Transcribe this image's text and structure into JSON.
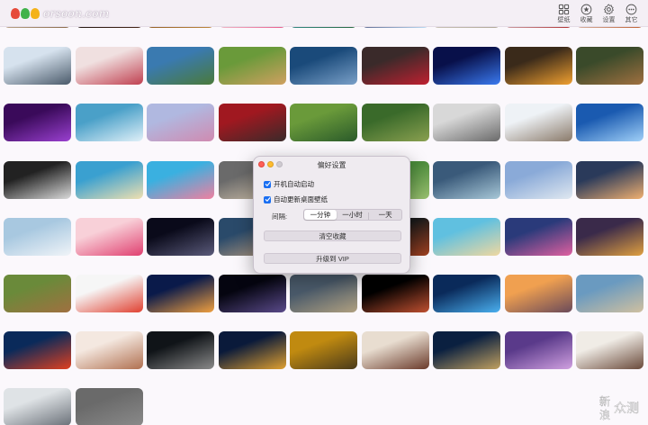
{
  "app": {
    "logo_text": "orsoon.com",
    "logo_letters": [
      "d",
      "i",
      "y"
    ],
    "watermark_text": "新浪众测"
  },
  "toolbar": {
    "buttons": [
      {
        "label": "壁纸",
        "icon": "grid-icon"
      },
      {
        "label": "收藏",
        "icon": "star-icon"
      },
      {
        "label": "设置",
        "icon": "gear-icon"
      },
      {
        "label": "其它",
        "icon": "more-icon"
      }
    ]
  },
  "gallery": {
    "tiles": [
      {
        "subject": "white bird flying",
        "colors": [
          "#d8c8b0",
          "#8a6a4a"
        ]
      },
      {
        "subject": "sports car at night",
        "colors": [
          "#121212",
          "#4a2a1a"
        ]
      },
      {
        "subject": "lion",
        "colors": [
          "#7a4a1a",
          "#c08a40"
        ]
      },
      {
        "subject": "happy birthday cupcakes",
        "colors": [
          "#f6f4ee",
          "#e85a8a"
        ]
      },
      {
        "subject": "green islands bay",
        "colors": [
          "#3aa0b0",
          "#2a6a40"
        ]
      },
      {
        "subject": "fantasy ice castle",
        "colors": [
          "#2a2a5a",
          "#c0e0f8"
        ]
      },
      {
        "subject": "desert lizard",
        "colors": [
          "#d8d2c8",
          "#b0a898"
        ]
      },
      {
        "subject": "red car and house",
        "colors": [
          "#dfe6ee",
          "#b03030"
        ]
      },
      {
        "subject": "fox in snow",
        "colors": [
          "#e6e8ee",
          "#c06030"
        ]
      },
      {
        "subject": "snowy mountains",
        "colors": [
          "#d6e2ee",
          "#4a5a6a"
        ]
      },
      {
        "subject": "cherry blossom village",
        "colors": [
          "#f0e0e0",
          "#c04050"
        ]
      },
      {
        "subject": "alpine lake",
        "colors": [
          "#3a7ab0",
          "#4a7a3a"
        ]
      },
      {
        "subject": "kitten on grass",
        "colors": [
          "#6a9a3a",
          "#d0a060"
        ]
      },
      {
        "subject": "blue lake at dusk",
        "colors": [
          "#1a4a7a",
          "#7aa0c8"
        ]
      },
      {
        "subject": "woman in red",
        "colors": [
          "#3a2a2a",
          "#c02030"
        ]
      },
      {
        "subject": "blue butterfly",
        "colors": [
          "#08104a",
          "#3a7af0"
        ]
      },
      {
        "subject": "sunset field tree",
        "colors": [
          "#3a2a1a",
          "#f0a030"
        ]
      },
      {
        "subject": "monkey in forest",
        "colors": [
          "#3a4a2a",
          "#a07040"
        ]
      },
      {
        "subject": "purple abstract",
        "colors": [
          "#3a0a5a",
          "#9a40d0"
        ]
      },
      {
        "subject": "helicopter over sea",
        "colors": [
          "#4aa0c8",
          "#e0f0f8"
        ]
      },
      {
        "subject": "hydrangea flowers",
        "colors": [
          "#b0b8e0",
          "#d08ab0"
        ]
      },
      {
        "subject": "red abstract",
        "colors": [
          "#a01820",
          "#3a2a2a"
        ]
      },
      {
        "subject": "green abstract",
        "colors": [
          "#6a9a3a",
          "#2a5a2a"
        ]
      },
      {
        "subject": "forest green",
        "colors": [
          "#3a6a2a",
          "#8aa050"
        ]
      },
      {
        "subject": "modern house with car",
        "colors": [
          "#d8d8d8",
          "#6a6a6a"
        ]
      },
      {
        "subject": "house in snow",
        "colors": [
          "#eef2f6",
          "#8a7a6a"
        ]
      },
      {
        "subject": "blue light hand",
        "colors": [
          "#1a5ab0",
          "#a0d0f8"
        ]
      },
      {
        "subject": "dark monochrome scene",
        "colors": [
          "#222222",
          "#dadada"
        ]
      },
      {
        "subject": "beach with deck chairs",
        "colors": [
          "#3aa0d0",
          "#f0e0b0"
        ]
      },
      {
        "subject": "dog with sunglasses",
        "colors": [
          "#3ab0e0",
          "#f080a0"
        ]
      },
      {
        "subject": "two kittens",
        "colors": [
          "#6a6a6a",
          "#d8c8b0"
        ]
      },
      {
        "subject": "lamp with sheep",
        "colors": [
          "#c8c8d0",
          "#8a8a92"
        ]
      },
      {
        "subject": "green sky",
        "colors": [
          "#4a8a3a",
          "#9ac070"
        ]
      },
      {
        "subject": "aerial river",
        "colors": [
          "#3a5a7a",
          "#a8c8d8"
        ]
      },
      {
        "subject": "jet plane over clouds",
        "colors": [
          "#8aaad8",
          "#e0e8f0"
        ]
      },
      {
        "subject": "pier at sunset",
        "colors": [
          "#2a3a5a",
          "#f0b070"
        ]
      },
      {
        "subject": "penguin on ice",
        "colors": [
          "#a8c8e0",
          "#f0f4f8"
        ]
      },
      {
        "subject": "pink hearts",
        "colors": [
          "#f8d0d8",
          "#e04070"
        ]
      },
      {
        "subject": "milky way night",
        "colors": [
          "#0a0a1a",
          "#5a5a7a"
        ]
      },
      {
        "subject": "city waterfront",
        "colors": [
          "#2a4a6a",
          "#c0a080"
        ]
      },
      {
        "subject": "tropical cocktails",
        "colors": [
          "#70c8e8",
          "#f0a040"
        ]
      },
      {
        "subject": "spices on table",
        "colors": [
          "#1a1a1a",
          "#a04020"
        ]
      },
      {
        "subject": "starfish beach",
        "colors": [
          "#60c0e0",
          "#f0d8a0"
        ]
      },
      {
        "subject": "anime girls",
        "colors": [
          "#2a3a7a",
          "#e060a0"
        ]
      },
      {
        "subject": "girl in street night",
        "colors": [
          "#3a2a4a",
          "#e0a040"
        ]
      },
      {
        "subject": "hedgehog on grass",
        "colors": [
          "#6a8a3a",
          "#a07040"
        ]
      },
      {
        "subject": "fruit clock",
        "colors": [
          "#f6f6f6",
          "#e04030"
        ]
      },
      {
        "subject": "city skyline night",
        "colors": [
          "#0a1a4a",
          "#f0a040"
        ]
      },
      {
        "subject": "deep space nebula",
        "colors": [
          "#050510",
          "#5a4a8a"
        ]
      },
      {
        "subject": "airplane over mountains",
        "colors": [
          "#4a5a6a",
          "#b0a080"
        ]
      },
      {
        "subject": "red planet",
        "colors": [
          "#000000",
          "#c05030"
        ]
      },
      {
        "subject": "glowing planet",
        "colors": [
          "#0a2a5a",
          "#4ab0f0"
        ]
      },
      {
        "subject": "paris sunset",
        "colors": [
          "#f0a050",
          "#6a4a5a"
        ]
      },
      {
        "subject": "sea rocks sunset",
        "colors": [
          "#6a9ac0",
          "#d0c0a0"
        ]
      },
      {
        "subject": "fiery ocean wave",
        "colors": [
          "#0a2a5a",
          "#e04020"
        ]
      },
      {
        "subject": "rope knot",
        "colors": [
          "#f4e8e0",
          "#b07050"
        ]
      },
      {
        "subject": "car at night",
        "colors": [
          "#101418",
          "#8a8a8a"
        ]
      },
      {
        "subject": "neon city night",
        "colors": [
          "#0a1a3a",
          "#e0a030"
        ]
      },
      {
        "subject": "yellow maple leaves",
        "colors": [
          "#c08a10",
          "#4a3a1a"
        ]
      },
      {
        "subject": "cake on plate",
        "colors": [
          "#e8ddd0",
          "#6a3a2a"
        ]
      },
      {
        "subject": "city bridge night",
        "colors": [
          "#0a2040",
          "#c0a060"
        ]
      },
      {
        "subject": "lavender field",
        "colors": [
          "#5a3a8a",
          "#d0a0e0"
        ]
      },
      {
        "subject": "coffee cup",
        "colors": [
          "#f0ece6",
          "#6a4a3a"
        ]
      },
      {
        "subject": "silver sports car",
        "colors": [
          "#dfe3e6",
          "#6a7078"
        ]
      },
      {
        "subject": "hidden tile",
        "colors": [
          "#6a6a6a",
          "#8a8a8a"
        ]
      }
    ]
  },
  "preferences": {
    "title": "偏好设置",
    "launch_at_login": {
      "label": "开机自动启动",
      "checked": true
    },
    "auto_update_wallpaper": {
      "label": "自动更新桌面壁纸",
      "checked": true
    },
    "interval": {
      "label": "间隔:",
      "options": [
        "一分钟",
        "一小时",
        "一天"
      ],
      "selected": "一分钟"
    },
    "clear_favorites_label": "清空收藏",
    "upgrade_vip_label": "升级到 VIP"
  }
}
